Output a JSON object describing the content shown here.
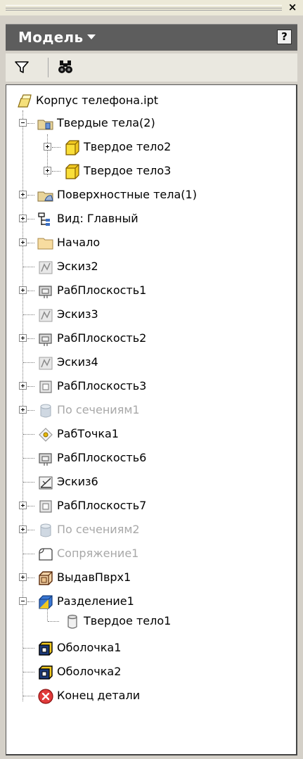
{
  "window": {
    "close_glyph": "×"
  },
  "panel": {
    "title": "Модель",
    "help_label": "?"
  },
  "toolbar": {
    "filter_icon": "filter-icon",
    "find_icon": "binoculars-icon"
  },
  "tree": {
    "root": {
      "label": "Корпус телефона.ipt",
      "icon": "part-file-icon"
    },
    "solid_bodies": {
      "label": "Твердые тела(2)",
      "icon": "solid-bodies-folder-icon",
      "expanded": true,
      "children": [
        {
          "label": "Твердое тело2",
          "icon": "solid-body-icon"
        },
        {
          "label": "Твердое тело3",
          "icon": "solid-body-icon"
        }
      ]
    },
    "items": [
      {
        "label": "Поверхностные тела(1)",
        "icon": "surface-bodies-folder-icon",
        "expander": "plus",
        "disabled": false
      },
      {
        "label": "Вид: Главный",
        "icon": "view-rep-icon",
        "expander": "plus",
        "disabled": false
      },
      {
        "label": "Начало",
        "icon": "origin-folder-icon",
        "expander": "plus",
        "disabled": false
      },
      {
        "label": "Эскиз2",
        "icon": "sketch-icon",
        "expander": "none",
        "disabled": false
      },
      {
        "label": "РабПлоскость1",
        "icon": "work-plane-icon",
        "expander": "plus",
        "disabled": false
      },
      {
        "label": "Эскиз3",
        "icon": "sketch-icon",
        "expander": "none",
        "disabled": false
      },
      {
        "label": "РабПлоскость2",
        "icon": "work-plane-icon",
        "expander": "plus",
        "disabled": false
      },
      {
        "label": "Эскиз4",
        "icon": "sketch-icon",
        "expander": "none",
        "disabled": false
      },
      {
        "label": "РабПлоскость3",
        "icon": "work-plane-icon",
        "expander": "plus",
        "disabled": false
      },
      {
        "label": "По сечениям1",
        "icon": "loft-icon",
        "expander": "plus",
        "disabled": true
      },
      {
        "label": "РабТочка1",
        "icon": "work-point-icon",
        "expander": "none",
        "disabled": false
      },
      {
        "label": "РабПлоскость6",
        "icon": "work-plane-icon",
        "expander": "none",
        "disabled": false
      },
      {
        "label": "Эскиз6",
        "icon": "sketch-icon",
        "expander": "none",
        "disabled": false
      },
      {
        "label": "РабПлоскость7",
        "icon": "work-plane-icon",
        "expander": "plus",
        "disabled": false
      },
      {
        "label": "По сечениям2",
        "icon": "loft-icon",
        "expander": "plus",
        "disabled": true
      },
      {
        "label": "Сопряжение1",
        "icon": "fillet-icon",
        "expander": "none",
        "disabled": true
      },
      {
        "label": "ВыдавПврх1",
        "icon": "extrude-surface-icon",
        "expander": "plus",
        "disabled": false
      },
      {
        "label": "Разделение1",
        "icon": "split-icon",
        "expander": "minus",
        "disabled": false
      },
      {
        "label": "Твердое тело1",
        "icon": "solid-body-cylinder-icon",
        "expander": "child",
        "disabled": false
      },
      {
        "label": "Оболочка1",
        "icon": "shell-icon",
        "expander": "none",
        "disabled": false
      },
      {
        "label": "Оболочка2",
        "icon": "shell-icon",
        "expander": "none",
        "disabled": false
      },
      {
        "label": "Конец детали",
        "icon": "end-of-part-icon",
        "expander": "none",
        "disabled": false
      }
    ]
  }
}
